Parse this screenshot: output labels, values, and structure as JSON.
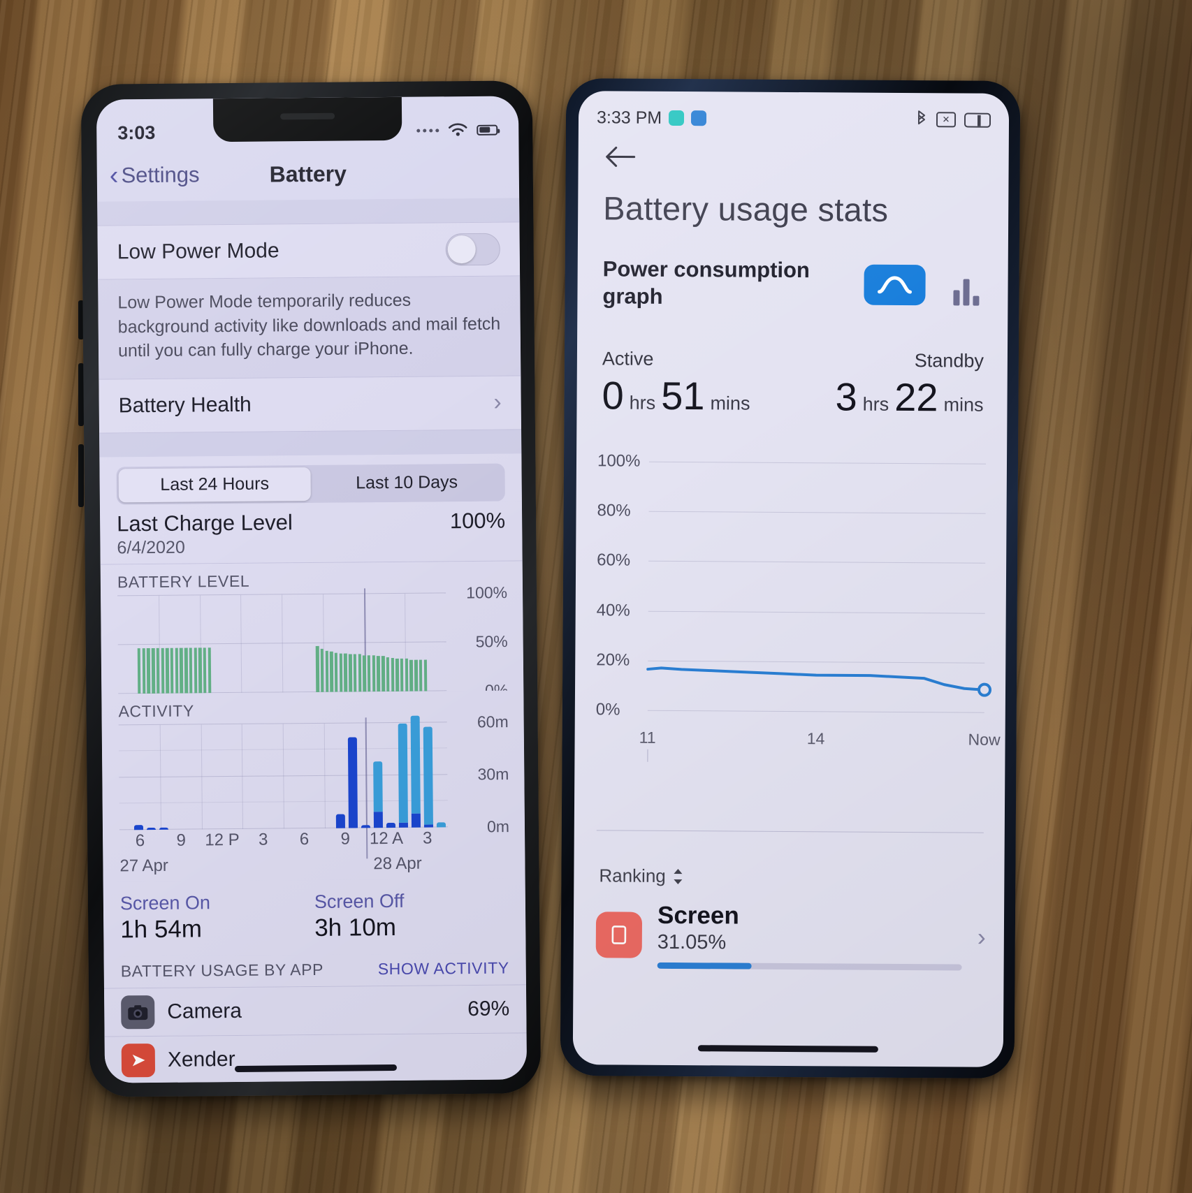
{
  "scene": {
    "description": "Two phones on a wooden desk showing battery statistics screens"
  },
  "iphone": {
    "status": {
      "time": "3:03",
      "signal_icon": "signal-dots-icon",
      "wifi_icon": "wifi-icon",
      "battery_icon": "battery-icon"
    },
    "nav": {
      "back_label": "Settings",
      "back_icon": "chevron-left-icon",
      "title": "Battery"
    },
    "low_power": {
      "label": "Low Power Mode",
      "toggle_state": "off"
    },
    "low_power_note": "Low Power Mode temporarily reduces background activity like downloads and mail fetch until you can fully charge your iPhone.",
    "battery_health": {
      "label": "Battery Health",
      "chevron_icon": "chevron-right-icon"
    },
    "segmented": {
      "options": [
        "Last 24 Hours",
        "Last 10 Days"
      ],
      "selected": "Last 24 Hours"
    },
    "last_charge": {
      "label": "Last Charge Level",
      "date": "6/4/2020",
      "value": "100%"
    },
    "battery_level_header": "BATTERY LEVEL",
    "activity_header": "ACTIVITY",
    "screen_on": {
      "label": "Screen On",
      "value": "1h 54m"
    },
    "screen_off": {
      "label": "Screen Off",
      "value": "3h 10m"
    },
    "usage_section": {
      "title": "BATTERY USAGE BY APP",
      "action": "SHOW ACTIVITY"
    },
    "apps": [
      {
        "name": "Camera",
        "percent": "69%",
        "icon": "camera-icon",
        "icon_bg": "#5c5c6e"
      },
      {
        "name": "Xender",
        "percent": "",
        "icon": "xender-icon",
        "icon_bg": "#d94b3a"
      }
    ],
    "colors": {
      "screen_bg": "#dedcf1",
      "accent": "#4a4ab0",
      "battery_green": "#63b187",
      "activity_dark_blue": "#1b46d0",
      "activity_light_blue": "#3a9fdc"
    }
  },
  "android": {
    "status": {
      "time": "3:33 PM",
      "app_icon_1": "app-badge-teal-icon",
      "app_icon_2": "app-badge-blue-icon",
      "bluetooth_icon": "bluetooth-icon",
      "silent_icon": "mute-icon",
      "battery_icon": "battery-icon"
    },
    "back_icon": "arrow-left-icon",
    "title": "Battery usage stats",
    "power_graph": {
      "label": "Power consumption graph",
      "toggle_line_icon": "line-graph-icon",
      "toggle_bar_icon": "bar-graph-icon",
      "selected": "line"
    },
    "active": {
      "label": "Active",
      "hours": "0",
      "hours_unit": "hrs",
      "mins": "51",
      "mins_unit": "mins"
    },
    "standby": {
      "label": "Standby",
      "hours": "3",
      "hours_unit": "hrs",
      "mins": "22",
      "mins_unit": "mins"
    },
    "ranking": {
      "label": "Ranking",
      "sort_icon": "sort-updown-icon"
    },
    "app": {
      "name": "Screen",
      "percent": "31.05%",
      "icon": "screen-icon",
      "progress": 31.05,
      "chevron_icon": "chevron-right-icon"
    },
    "colors": {
      "screen_bg": "#e4e3f2",
      "accent": "#1a7fdc",
      "app_icon_bg": "#eb6a63",
      "line": "#2a7fd4"
    }
  },
  "chart_data": [
    {
      "id": "iphone-battery-level",
      "type": "bar",
      "title": "BATTERY LEVEL",
      "xlabel": "",
      "ylabel": "",
      "ylim": [
        0,
        100
      ],
      "ytick_labels": [
        "100%",
        "50%",
        "0%"
      ],
      "yticks": [
        100,
        50,
        0
      ],
      "xtick_labels": [
        "6",
        "9",
        "12 P",
        "3",
        "6",
        "9",
        "12 A",
        "3"
      ],
      "day_labels": [
        "27 Apr",
        "28 Apr"
      ],
      "grid": true,
      "legend": "none",
      "series": [
        {
          "name": "Battery level (%)",
          "color": "#63b187",
          "values": [
            null,
            null,
            null,
            null,
            46,
            46,
            46,
            46,
            46,
            46,
            46,
            46,
            46,
            46,
            46,
            46,
            46,
            46,
            46,
            46,
            null,
            null,
            null,
            null,
            null,
            null,
            null,
            null,
            null,
            null,
            null,
            null,
            null,
            null,
            null,
            null,
            null,
            null,
            null,
            null,
            null,
            null,
            47,
            44,
            42,
            41,
            40,
            39,
            39,
            38,
            38,
            38,
            37,
            37,
            37,
            36,
            36,
            35,
            34,
            33,
            33,
            33,
            32,
            32,
            32,
            32,
            null,
            null,
            null,
            null
          ]
        }
      ]
    },
    {
      "id": "iphone-activity",
      "type": "bar",
      "title": "ACTIVITY",
      "xlabel": "",
      "ylabel": "",
      "ylim": [
        0,
        60
      ],
      "ytick_labels": [
        "60m",
        "30m",
        "0m"
      ],
      "yticks": [
        60,
        30,
        0
      ],
      "xtick_labels": [
        "6",
        "9",
        "12 P",
        "3",
        "6",
        "9",
        "12 A",
        "3"
      ],
      "day_labels": [
        "27 Apr",
        "28 Apr"
      ],
      "grid": true,
      "legend": "none",
      "stacked": true,
      "series": [
        {
          "name": "Screen On",
          "color": "#1b46d0",
          "values": [
            0,
            2.5,
            1.2,
            1.2,
            0,
            0,
            0,
            0,
            0,
            0,
            0,
            0,
            0,
            0,
            0,
            0,
            0,
            8,
            52,
            1.5,
            9,
            2.5,
            2.5,
            8,
            1.5
          ]
        },
        {
          "name": "Screen Off",
          "color": "#3a9fdc",
          "values": [
            0,
            0,
            0,
            0,
            0,
            0,
            0,
            0,
            0,
            0,
            0,
            0,
            0,
            0,
            0,
            0,
            0,
            0,
            0,
            0,
            29,
            0,
            57,
            56,
            56,
            2.5
          ]
        }
      ]
    },
    {
      "id": "android-power-consumption",
      "type": "line",
      "title": "Power consumption graph",
      "xlabel": "",
      "ylabel": "",
      "ylim": [
        0,
        100
      ],
      "ytick_labels": [
        "100%",
        "80%",
        "60%",
        "40%",
        "20%",
        "0%"
      ],
      "yticks": [
        100,
        80,
        60,
        40,
        20,
        0
      ],
      "xtick_labels": [
        "11",
        "14",
        "Now"
      ],
      "grid": true,
      "legend": "none",
      "series": [
        {
          "name": "Battery level (%)",
          "color": "#2a7fd4",
          "x": [
            0,
            4,
            10,
            20,
            30,
            40,
            50,
            58,
            66,
            74,
            82,
            88,
            94,
            100
          ],
          "values": [
            16.5,
            17,
            16.5,
            16,
            15.5,
            15,
            14.5,
            14.5,
            14.5,
            14,
            13.5,
            11,
            9.5,
            9
          ]
        }
      ],
      "end_marker": true
    }
  ]
}
